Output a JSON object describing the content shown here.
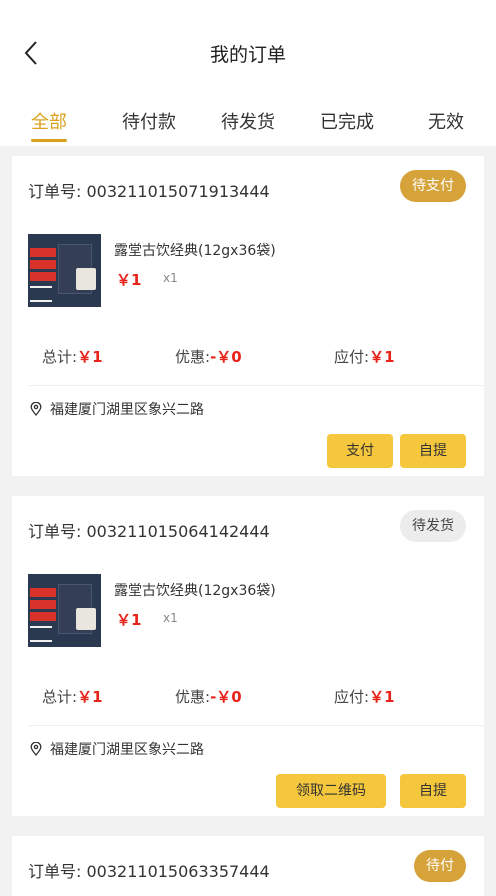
{
  "header": {
    "title": "我的订单",
    "back_icon": "chevron-left-icon"
  },
  "tabs": [
    {
      "label": "全部",
      "active": true
    },
    {
      "label": "待付款"
    },
    {
      "label": "待发货"
    },
    {
      "label": "已完成"
    },
    {
      "label": "无效"
    }
  ],
  "colors": {
    "accent": "#d9a21f",
    "price": "#e8231a",
    "button": "#f5c73c",
    "badge_pay": "#d6a23a"
  },
  "orders": [
    {
      "order_label": "订单号: ",
      "order_no": "003211015071913444",
      "status": "待支付",
      "product": {
        "name": "露堂古饮经典(12gx36袋)",
        "price": "￥1",
        "qty": "x1"
      },
      "total_label": "总计:",
      "total": "￥1",
      "discount_label": "优惠:",
      "discount": "-￥0",
      "due_label": "应付:",
      "due": "￥1",
      "address": "福建厦门湖里区象兴二路",
      "actions": [
        "支付",
        "自提"
      ]
    },
    {
      "order_label": "订单号: ",
      "order_no": "003211015064142444",
      "status": "待发货",
      "product": {
        "name": "露堂古饮经典(12gx36袋)",
        "price": "￥1",
        "qty": "x1"
      },
      "total_label": "总计:",
      "total": "￥1",
      "discount_label": "优惠:",
      "discount": "-￥0",
      "due_label": "应付:",
      "due": "￥1",
      "address": "福建厦门湖里区象兴二路",
      "actions": [
        "领取二维码",
        "自提"
      ]
    },
    {
      "order_label": "订单号: ",
      "order_no": "003211015063357444",
      "status": "待付"
    }
  ]
}
